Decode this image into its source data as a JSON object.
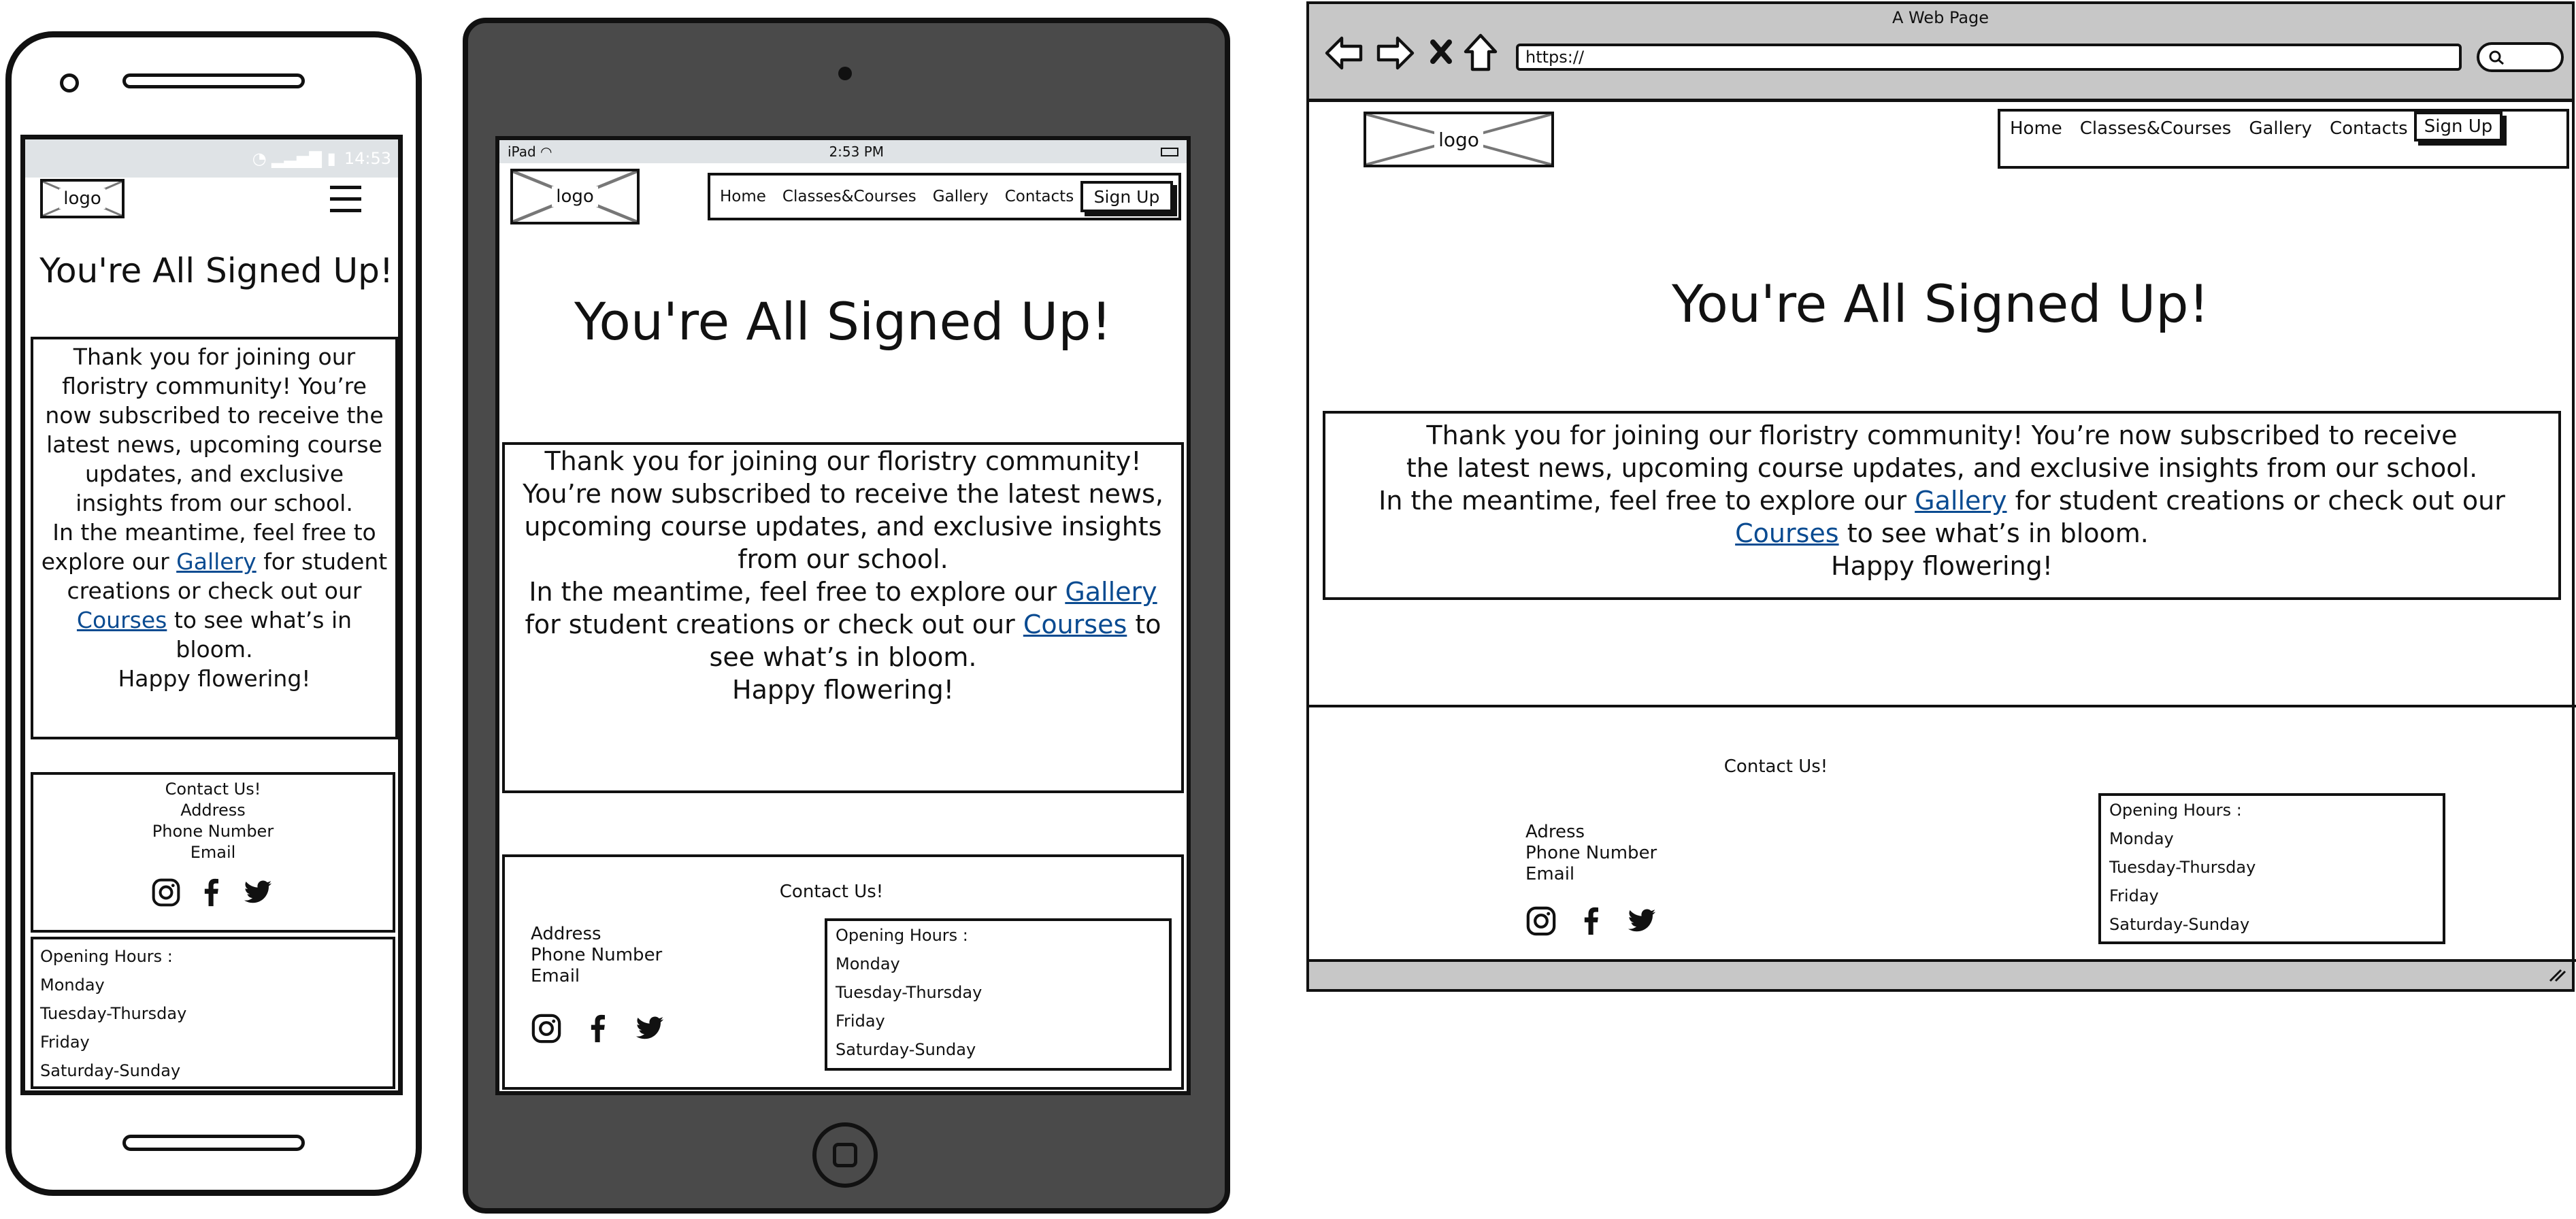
{
  "site": {
    "logo": "logo",
    "nav": [
      "Home",
      "Classes&Courses",
      "Gallery",
      "Contacts"
    ],
    "signup": "Sign Up",
    "heading": "You're All Signed Up!",
    "paragraph1": "Thank you for joining our floristry community! You’re now subscribed to receive the latest news, upcoming course updates, and exclusive insights from our school.",
    "paragraph2_pre": "In the meantime, feel free to explore our",
    "gallery_link": "Gallery",
    "paragraph2_mid": "for student creations or check out our",
    "courses_link": "Courses",
    "paragraph2_post": "to see what’s in bloom.",
    "paragraph3": "Happy flowering!",
    "link_color": "#0a4b91",
    "footer": {
      "contact_title": "Contact Us!",
      "address": "Address",
      "address_browser": "Adress",
      "phone": "Phone Number",
      "email": "Email",
      "social_icons": [
        "instagram-icon",
        "facebook-icon",
        "twitter-icon"
      ],
      "hours_title": "Opening Hours :",
      "days": [
        "Monday",
        "Tuesday-Thursday",
        "Friday",
        "Saturday-Sunday"
      ]
    }
  },
  "phone": {
    "status_time": "14:53"
  },
  "tablet": {
    "status_left": "iPad",
    "status_time": "2:53 PM"
  },
  "browser": {
    "title": "A Web Page",
    "url": "https://"
  }
}
